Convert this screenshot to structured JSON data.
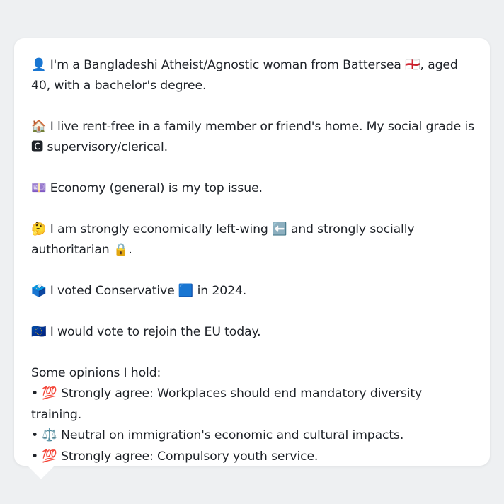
{
  "persona": {
    "paragraphs": [
      "👤 I'm a Bangladeshi Atheist/Agnostic woman from Battersea 🏴󠁧󠁢󠁥󠁮󠁧󠁿, aged 40, with a bachelor's degree.",
      "🏠 I live rent-free in a family member or friend's home. My social grade is 🅲 supervisory/clerical.",
      "💷 Economy (general) is my top issue.",
      "🤔 I am strongly economically left-wing ⬅️ and strongly socially authoritarian 🔒.",
      "🗳️ I voted Conservative 🟦 in 2024.",
      "🇪🇺 I would vote to rejoin the EU today."
    ],
    "opinions_heading": "Some opinions I hold:",
    "opinions": [
      "• 💯 Strongly agree: Workplaces should end mandatory diversity training.",
      "• ⚖️ Neutral on immigration's economic and cultural impacts.",
      "• 💯 Strongly agree: Compulsory youth service."
    ]
  }
}
